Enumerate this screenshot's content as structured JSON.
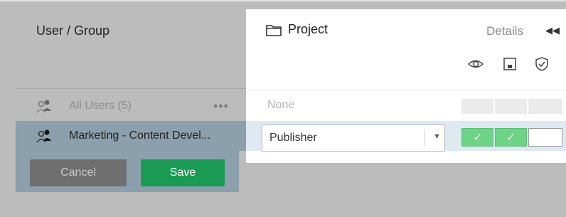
{
  "users_panel": {
    "header": "User / Group",
    "rows": [
      {
        "label": "All Users (5)",
        "icon": "user-group-icon",
        "more": "•••"
      },
      {
        "label": "Marketing - Content Devel...",
        "icon": "user-group-icon"
      }
    ],
    "cancel_label": "Cancel",
    "save_label": "Save"
  },
  "project_panel": {
    "title": "Project",
    "title_icon": "folder-icon",
    "details_label": "Details",
    "collapse_icon": "double-chevron-left-icon",
    "capability_icons": [
      "eye-icon",
      "save-disk-icon",
      "shield-check-icon"
    ],
    "all_users_role": "None",
    "marketing_role": "Publisher",
    "marketing_capabilities": [
      {
        "state": "allowed",
        "mark": "✓"
      },
      {
        "state": "allowed",
        "mark": "✓"
      },
      {
        "state": "unset",
        "mark": ""
      }
    ]
  },
  "colors": {
    "overlay_gray": "#bcbcbc",
    "selection_blue_gray": "#8c9fac",
    "save_green": "#1b9a55",
    "allowed_green": "#6dd487",
    "selected_row_blue": "#dfe9f2"
  }
}
